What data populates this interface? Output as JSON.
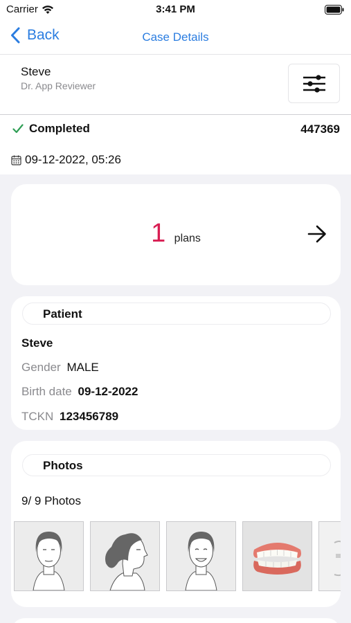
{
  "status_bar": {
    "carrier": "Carrier",
    "time": "3:41 PM"
  },
  "nav": {
    "back_label": "Back",
    "title": "Case Details"
  },
  "user": {
    "name": "Steve",
    "subtitle": "Dr. App Reviewer"
  },
  "case": {
    "status": "Completed",
    "id": "447369",
    "datetime": "09-12-2022, 05:26",
    "status_color": "#2f9e55"
  },
  "plans": {
    "count": "1",
    "label": "plans",
    "count_color": "#d81d52"
  },
  "patient": {
    "section_title": "Patient",
    "name": "Steve",
    "gender_label": "Gender",
    "gender": "MALE",
    "birth_label": "Birth date",
    "birth_date": "09-12-2022",
    "tckn_label": "TCKN",
    "tckn": "123456789"
  },
  "photos": {
    "section_title": "Photos",
    "count_text": "9/ 9 Photos",
    "thumbnails": [
      "face-front-icon",
      "face-profile-icon",
      "face-smile-icon",
      "teeth-icon",
      "intraoral-icon"
    ]
  },
  "colors": {
    "accent": "#2b7de0"
  }
}
